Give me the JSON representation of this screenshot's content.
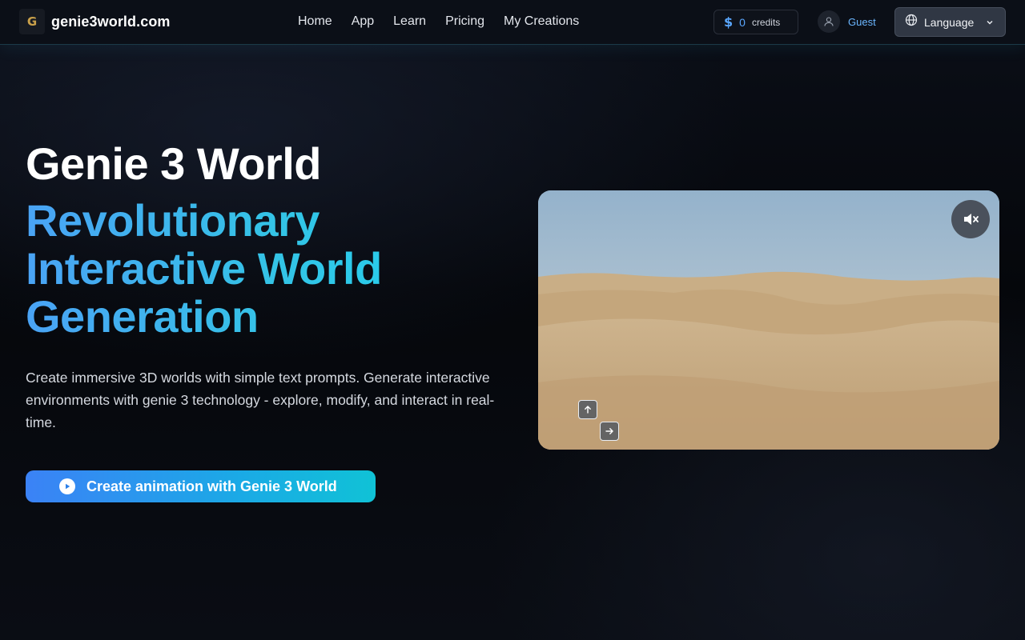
{
  "header": {
    "logo_letter": "G",
    "site_name": "genie3world.com",
    "nav": [
      {
        "label": "Home"
      },
      {
        "label": "App"
      },
      {
        "label": "Learn"
      },
      {
        "label": "Pricing"
      },
      {
        "label": "My Creations"
      }
    ],
    "credits": {
      "symbol": "$",
      "count": "0",
      "label": "credits"
    },
    "user": {
      "name": "Guest"
    },
    "language": {
      "label": "Language"
    }
  },
  "hero": {
    "title": "Genie 3 World",
    "subtitle": "Revolutionary Interactive World Generation",
    "description": "Create immersive 3D worlds with simple text prompts. Generate interactive environments with genie 3 technology - explore, modify, and interact in real-time.",
    "cta_label": "Create animation with Genie 3 World"
  },
  "video": {
    "mute_icon": "speaker-muted-icon",
    "keys": [
      {
        "icon": "arrow-up-icon",
        "glyph": "↑"
      },
      {
        "icon": "arrow-right-icon",
        "glyph": "→"
      }
    ]
  },
  "colors": {
    "accent_blue": "#3b82f6",
    "accent_cyan": "#22d3ee",
    "background": "#05070b"
  }
}
